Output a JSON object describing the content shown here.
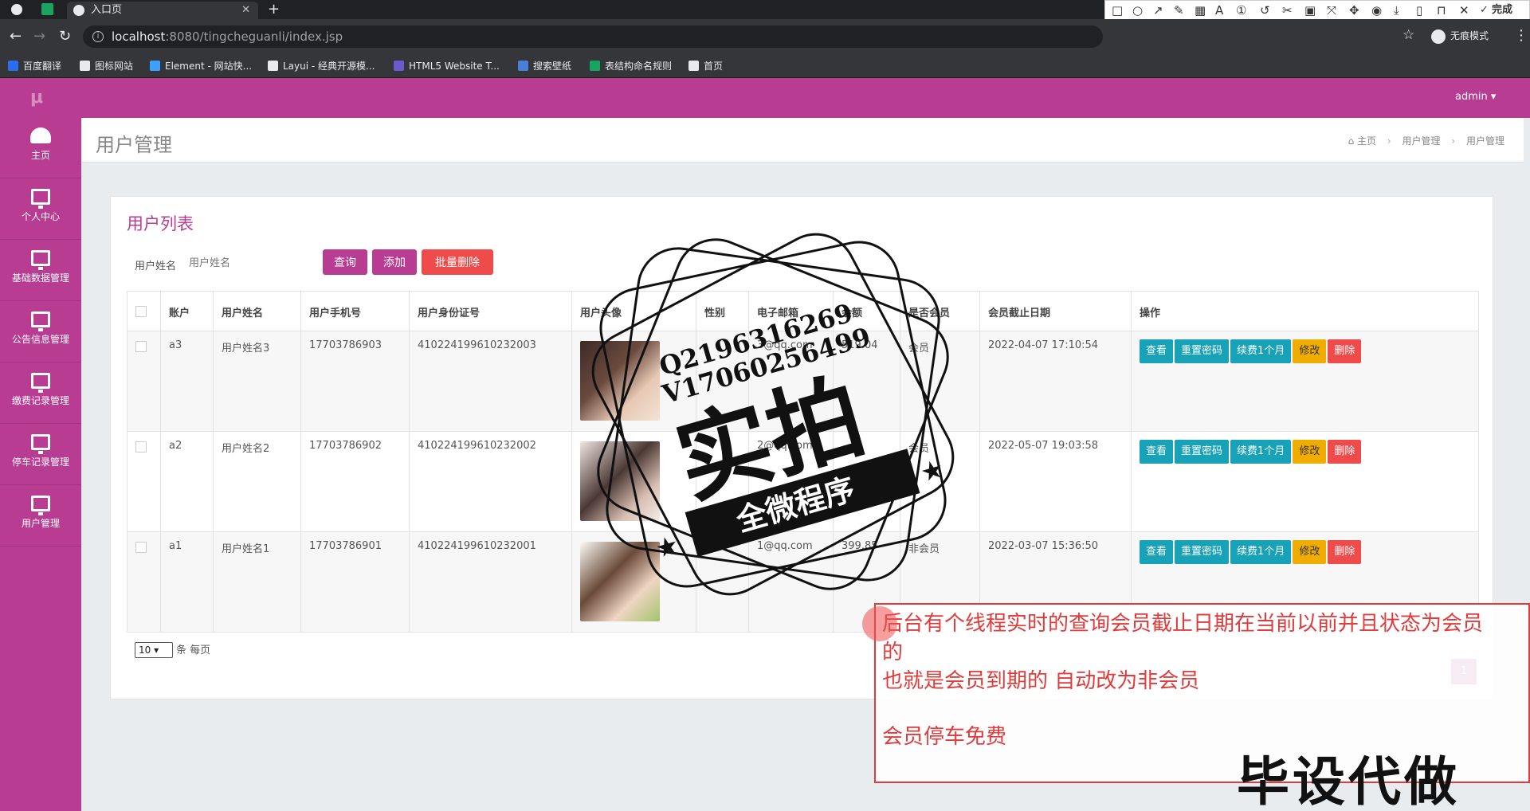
{
  "browser": {
    "tab_title": "入口页",
    "url_host": "localhost",
    "url_path": ":8080/tingcheguanli/index.jsp",
    "incognito_label": "无痕模式",
    "bookmarks": [
      {
        "label": "百度翻译",
        "color": "#2b6cf0"
      },
      {
        "label": "图标网站",
        "color": "#e8eaed"
      },
      {
        "label": "Element - 网站快...",
        "color": "#409eff"
      },
      {
        "label": "Layui - 经典开源模...",
        "color": "#e8eaed"
      },
      {
        "label": "HTML5 Website T...",
        "color": "#6a5acd"
      },
      {
        "label": "搜索壁纸",
        "color": "#4a7fd8"
      },
      {
        "label": "表结构命名规则",
        "color": "#1aa260"
      },
      {
        "label": "首页",
        "color": "#e8eaed"
      }
    ]
  },
  "screenshot_tool": {
    "font_size": "20",
    "done_label": "完成",
    "current_color": "#ff3333",
    "swatches": [
      "#000000",
      "#7f7f7f",
      "#880015",
      "#ed1c24",
      "#ff7f27",
      "#fff200",
      "#22b14c",
      "#00a2e8",
      "#3f48cc",
      "#a349a4",
      "#ffffff",
      "#c3c3c3",
      "#b97a57",
      "#ffaec9",
      "#ffc90e",
      "#efe4b0",
      "#b5e61d",
      "#99d9ea",
      "#7092be",
      "#c8bfe7"
    ]
  },
  "app": {
    "user": "admin ▾",
    "sidebar": [
      {
        "label": "主页",
        "icon": "dashboard-icon"
      },
      {
        "label": "个人中心",
        "icon": "monitor-icon"
      },
      {
        "label": "基础数据管理",
        "icon": "monitor-icon"
      },
      {
        "label": "公告信息管理",
        "icon": "monitor-icon"
      },
      {
        "label": "缴费记录管理",
        "icon": "monitor-icon"
      },
      {
        "label": "停车记录管理",
        "icon": "monitor-icon"
      },
      {
        "label": "用户管理",
        "icon": "monitor-icon"
      }
    ],
    "page_title": "用户管理",
    "breadcrumb": [
      "主页",
      "用户管理",
      "用户管理"
    ]
  },
  "list": {
    "title": "用户列表",
    "search_label": "用户姓名",
    "search_placeholder": "用户姓名",
    "btn_query": "查询",
    "btn_add": "添加",
    "btn_batch_delete": "批量删除",
    "columns": [
      "账户",
      "用户姓名",
      "用户手机号",
      "用户身份证号",
      "用户头像",
      "性别",
      "电子邮箱",
      "余额",
      "是否会员",
      "会员截止日期",
      "操作"
    ],
    "rows": [
      {
        "account": "a3",
        "name": "用户姓名3",
        "phone": "17703786903",
        "idcard": "410224199610232003",
        "gender": "",
        "email": "3@qq.com",
        "balance": "519.04",
        "member": "会员",
        "expire": "2022-04-07 17:10:54"
      },
      {
        "account": "a2",
        "name": "用户姓名2",
        "phone": "17703786902",
        "idcard": "410224199610232002",
        "gender": "",
        "email": "2@qq.com",
        "balance": "",
        "member": "会员",
        "expire": "2022-05-07 19:03:58"
      },
      {
        "account": "a1",
        "name": "用户姓名1",
        "phone": "17703786901",
        "idcard": "410224199610232001",
        "gender": "",
        "email": "1@qq.com",
        "balance": "399.85",
        "member": "非会员",
        "expire": "2022-03-07 15:36:50"
      }
    ],
    "ops": {
      "view": "查看",
      "reset": "重置密码",
      "renew": "续费1个月",
      "edit": "修改",
      "delete": "删除"
    },
    "page_size": "10",
    "page_size_suffix": "条 每页",
    "current_page": "1"
  },
  "watermark": {
    "line1": "Q2196316269",
    "line2": "V17060256499",
    "big": "实拍",
    "ribbon": "全微程序"
  },
  "annotation": {
    "line1": "后台有个线程实时的查询会员截止日期在当前以前并且状态为会员",
    "line2": "的",
    "line3": "也就是会员到期的  自动改为非会员",
    "line4": "会员停车免费"
  },
  "corner_text": "毕设代做"
}
